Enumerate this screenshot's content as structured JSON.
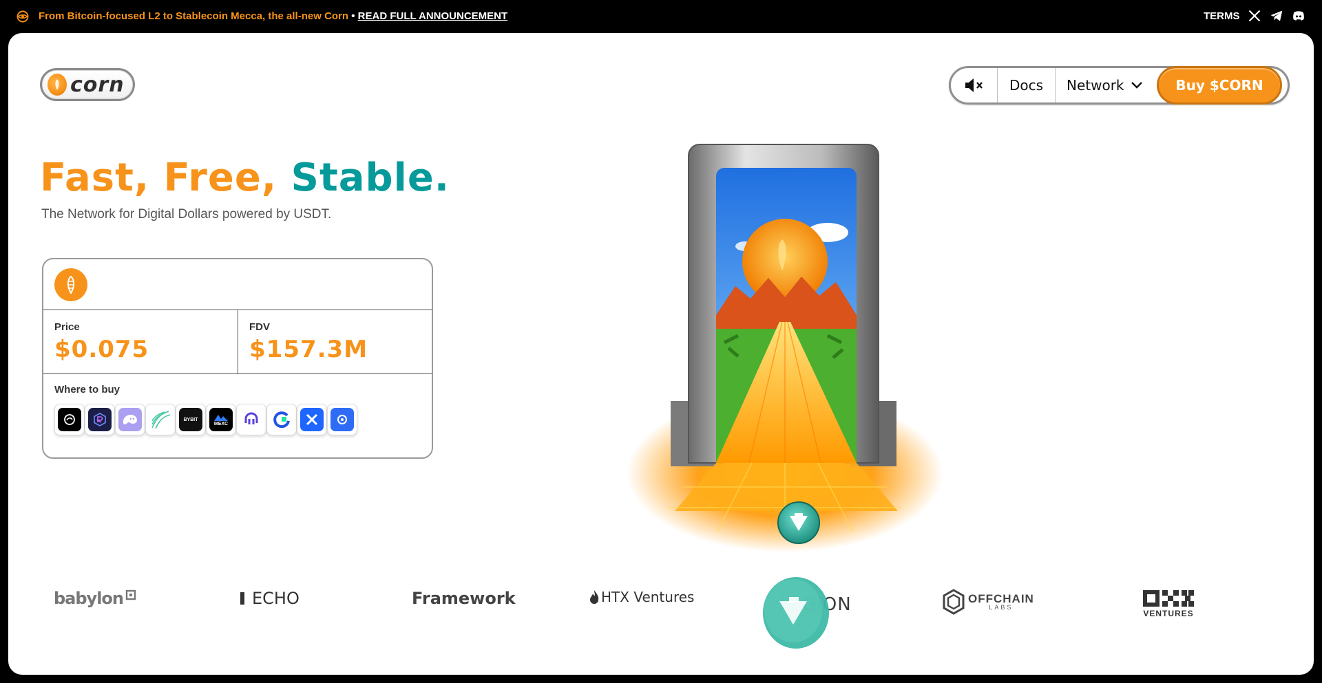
{
  "announcement": {
    "text": "From Bitcoin-focused L2 to Stablecoin Mecca, the all-new Corn",
    "separator": "•",
    "link": "READ FULL ANNOUNCEMENT",
    "terms": "TERMS"
  },
  "logo": {
    "word": "corn"
  },
  "nav": {
    "docs": "Docs",
    "network": "Network",
    "buy": "Buy $CORN"
  },
  "hero": {
    "headline_orange": "Fast, Free, ",
    "headline_teal": "Stable.",
    "subline": "The Network for Digital Dollars powered by USDT."
  },
  "stats": {
    "price_label": "Price",
    "price_value": "$0.075",
    "fdv_label": "FDV",
    "fdv_value": "$157.3M",
    "where_label": "Where to buy",
    "exchanges": [
      {
        "name": "OKX",
        "label": ""
      },
      {
        "name": "Raydium",
        "label": ""
      },
      {
        "name": "Phantom",
        "label": ""
      },
      {
        "name": "Hyperliquid",
        "label": ""
      },
      {
        "name": "Bybit",
        "label": "BYBIT"
      },
      {
        "name": "MEXC",
        "label": "MEXC"
      },
      {
        "name": "Kraken",
        "label": ""
      },
      {
        "name": "Gate",
        "label": ""
      },
      {
        "name": "Bitget",
        "label": ""
      },
      {
        "name": "Tokenlon",
        "label": ""
      }
    ]
  },
  "partners": [
    "babylon",
    "ECHO",
    "Framework",
    "HTX Ventures",
    "LEGION",
    "OFFCHAIN",
    "LABS",
    "OKX",
    "VENTURES"
  ],
  "colors": {
    "orange": "#f7931a",
    "teal": "#079a9a"
  }
}
